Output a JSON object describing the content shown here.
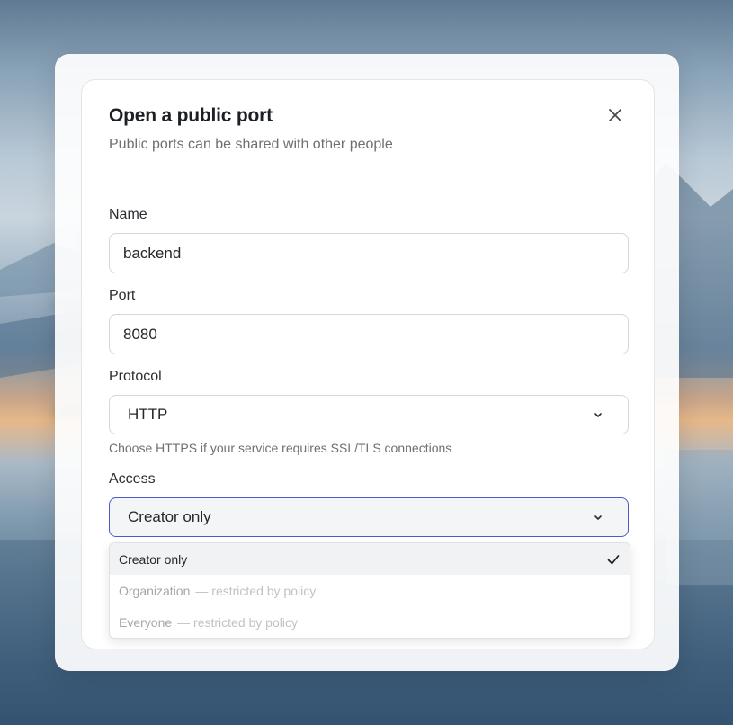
{
  "dialog": {
    "title": "Open a public port",
    "subtitle": "Public ports can be shared with other people",
    "close_icon": "close-icon"
  },
  "form": {
    "name": {
      "label": "Name",
      "value": "backend"
    },
    "port": {
      "label": "Port",
      "value": "8080"
    },
    "protocol": {
      "label": "Protocol",
      "value": "HTTP",
      "helper": "Choose HTTPS if your service requires SSL/TLS connections",
      "icon": "chevron-down-icon"
    },
    "access": {
      "label": "Access",
      "value": "Creator only",
      "icon": "chevron-down-icon",
      "options": [
        {
          "label": "Creator only",
          "note": "",
          "selected": true,
          "disabled": false
        },
        {
          "label": "Organization",
          "note": "— restricted by policy",
          "selected": false,
          "disabled": true
        },
        {
          "label": "Everyone",
          "note": "— restricted by policy",
          "selected": false,
          "disabled": true
        }
      ]
    }
  },
  "colors": {
    "accent": "#4a5bd0",
    "text_primary": "#1c1f23",
    "text_muted": "#6b7075",
    "disabled": "#a3a7ac"
  }
}
